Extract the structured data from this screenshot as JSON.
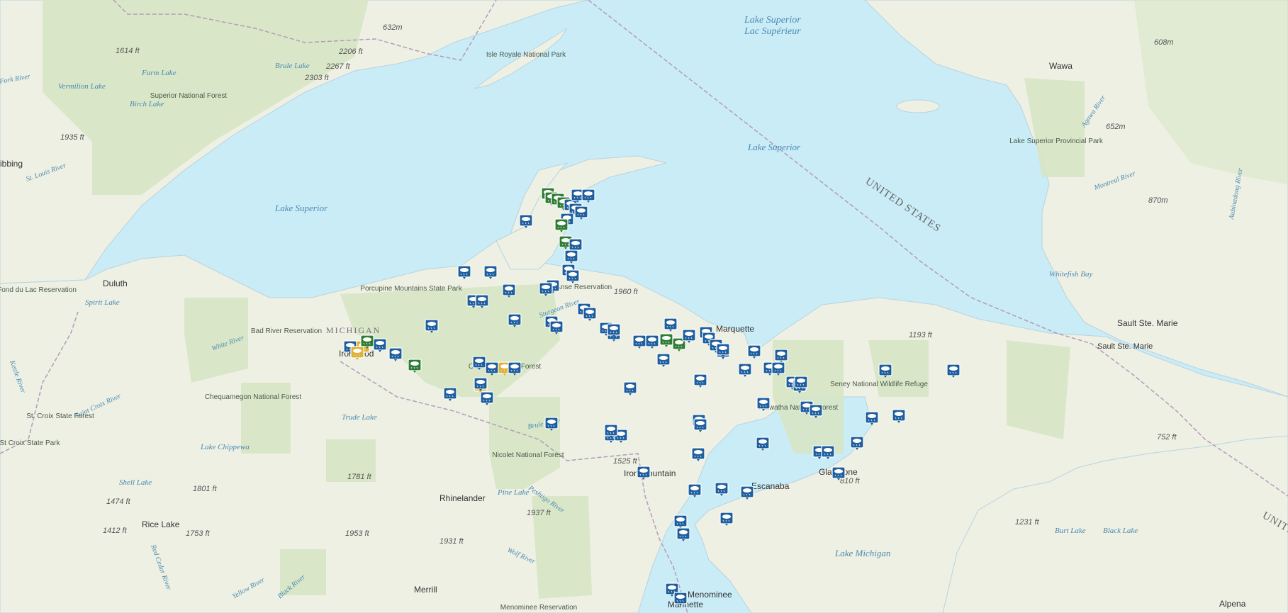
{
  "labels": {
    "cities": [
      "Duluth",
      "Wawa",
      "Sault Ste. Marie",
      "Sault Ste. Marie",
      "Marquette",
      "Escanaba",
      "Rhinelander",
      "Merrill",
      "Rice Lake",
      "Menominee",
      "Marinette",
      "Alpena",
      "Iron Mountain",
      "Ironwood",
      "Gladstone",
      "ibbing"
    ],
    "lakes": [
      "Lake Superior",
      "Lac Supérieur",
      "Lake Superior",
      "Lake Superior",
      "Lake Michigan",
      "Vermilion Lake",
      "Farm Lake",
      "Brule Lake",
      "Birch Lake",
      "Spirit Lake",
      "Trude Lake",
      "Lake Chippewa",
      "Shell Lake",
      "Pine Lake",
      "Burt Lake",
      "Black Lake",
      "Whitefish Bay"
    ],
    "rivers": [
      "St. Louis River",
      "White River",
      "Saint Croix River",
      "Kettle River",
      "Red Cedar River",
      "Yellow River",
      "Black River",
      "Wolf River",
      "Peshtigo River",
      "Brule River",
      "Agawa River",
      "Montreal River",
      "Aubinadong River",
      "Fork River",
      "Sturgeon River"
    ],
    "parks": [
      "Isle Royale National Park",
      "Superior National Forest",
      "Lake Superior Provincial Park",
      "Porcupine Mountains State Park",
      "L'Anse Reservation",
      "Bad River Reservation",
      "Chequamegon National Forest",
      "St. Croix State Forest",
      "St Croix State Park",
      "Fond du Lac Reservation",
      "Ottawa National Forest",
      "Nicolet National Forest",
      "Hiawatha National Forest",
      "Seney National Wildlife Refuge",
      "Menominee Reservation"
    ],
    "elevations": [
      "632m",
      "1614 ft",
      "2206 ft",
      "2267 ft",
      "2303 ft",
      "1935 ft",
      "608m",
      "652m",
      "870m",
      "1960 ft",
      "1193 ft",
      "752 ft",
      "810 ft",
      "1525 ft",
      "1781 ft",
      "1801 ft",
      "1474 ft",
      "1412 ft",
      "1753 ft",
      "1953 ft",
      "1937 ft",
      "1931 ft",
      "1231 ft"
    ],
    "states": [
      "MICHIGAN",
      "UNITED STATES",
      "UNITED STATES"
    ]
  },
  "markers": {
    "icon": "weather-station-icon",
    "count": 96
  },
  "colors": {
    "water": "#c9ecf7",
    "land": "#eef0e4",
    "forest": "#d6e6c4",
    "marker_blue": "#1f5f9e",
    "marker_green": "#2e7d32",
    "marker_yellow": "#e0b030"
  }
}
